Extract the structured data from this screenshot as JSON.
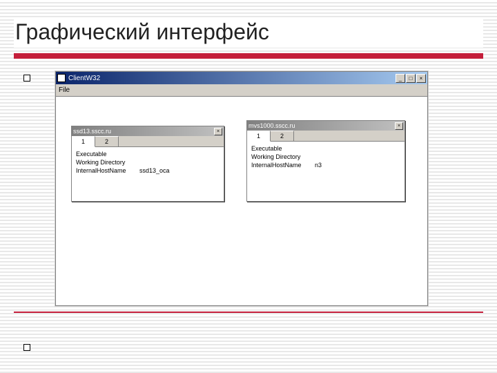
{
  "slide": {
    "title": "Графический интерфейс"
  },
  "outerWindow": {
    "title": "ClientW32",
    "menu": {
      "file": "File"
    },
    "buttons": {
      "min": "_",
      "max": "□",
      "close": "×"
    }
  },
  "leftWindow": {
    "title": "ssd13.sscc.ru",
    "buttons": {
      "close": "×"
    },
    "tabs": {
      "t1": "1",
      "t2": "2"
    },
    "rows": {
      "r1": {
        "label": "Executable",
        "value": ""
      },
      "r2": {
        "label": "Working Directory",
        "value": ""
      },
      "r3": {
        "label": "InternalHostName",
        "value": "ssd13_oca"
      }
    }
  },
  "rightWindow": {
    "title": "mvs1000.sscc.ru",
    "buttons": {
      "close": "×"
    },
    "tabs": {
      "t1": "1",
      "t2": "2"
    },
    "rows": {
      "r1": {
        "label": "Executable",
        "value": ""
      },
      "r2": {
        "label": "Working Directory",
        "value": ""
      },
      "r3": {
        "label": "InternalHostName",
        "value": "n3"
      }
    }
  }
}
